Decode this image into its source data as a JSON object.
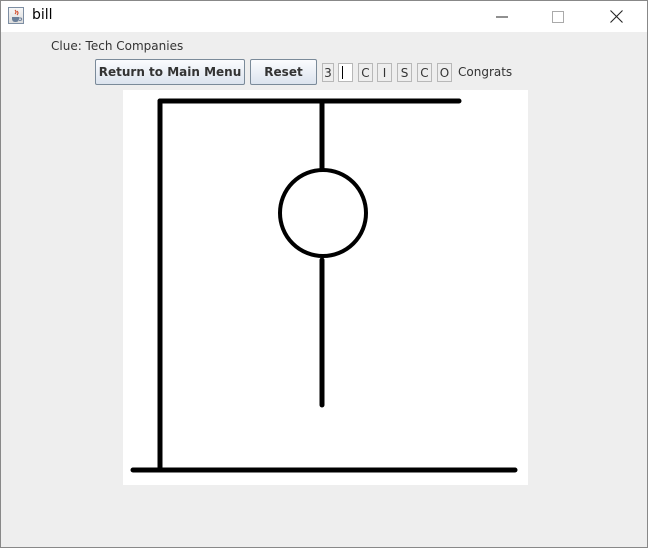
{
  "window": {
    "title": "bill",
    "icon": "java-cup-icon",
    "controls": [
      "minimize-icon",
      "maximize-icon",
      "close-icon"
    ]
  },
  "clue": "Clue: Tech Companies",
  "buttons": {
    "main_menu": "Return to Main Menu",
    "reset": "Reset"
  },
  "status": {
    "wrong_guesses": "3",
    "guess_input": "",
    "letters": [
      "C",
      "I",
      "S",
      "C",
      "O"
    ],
    "message": "Congrats"
  },
  "drawing": {
    "parts": [
      "gallows-base",
      "gallows-post",
      "gallows-beam",
      "rope",
      "head",
      "body"
    ]
  }
}
